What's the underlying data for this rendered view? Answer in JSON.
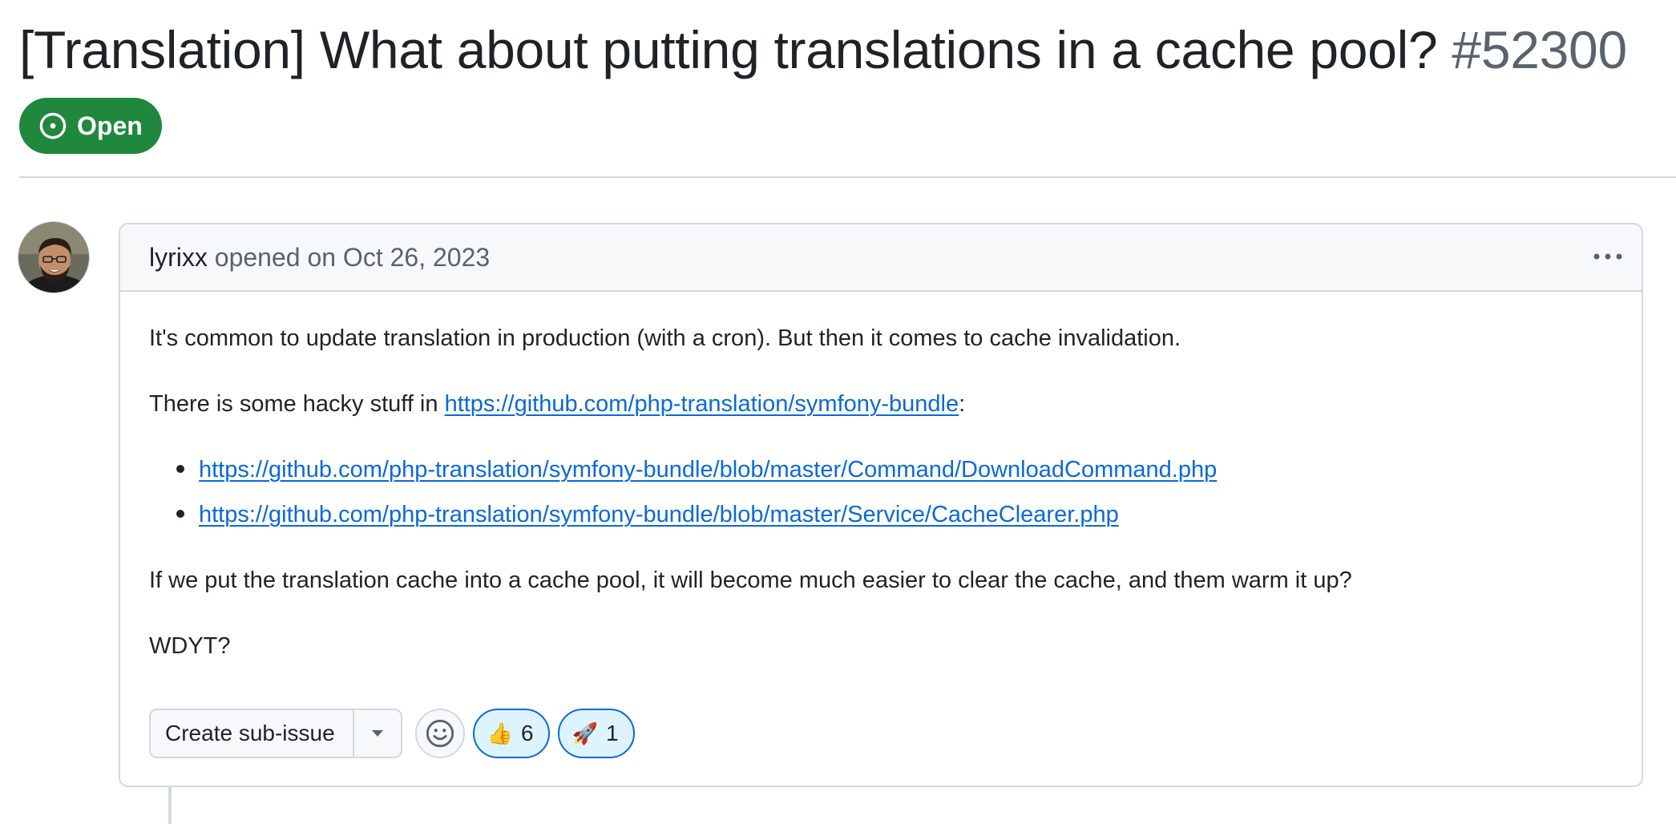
{
  "issue": {
    "title": "[Translation] What about putting translations in a cache pool?",
    "number": "#52300",
    "state": "Open",
    "state_color": "#1f883d"
  },
  "comment": {
    "author": "lyrixx",
    "opened_text": "opened on Oct 26, 2023",
    "body": {
      "p1": "It's common to update translation in production (with a cron). But then it comes to cache invalidation.",
      "p2_prefix": "There is some hacky stuff in ",
      "p2_link": "https://github.com/php-translation/symfony-bundle",
      "p2_suffix": ":",
      "bullets": [
        "https://github.com/php-translation/symfony-bundle/blob/master/Command/DownloadCommand.php",
        "https://github.com/php-translation/symfony-bundle/blob/master/Service/CacheClearer.php"
      ],
      "p3": "If we put the translation cache into a cache pool, it will become much easier to clear the cache, and them warm it up?",
      "p4": "WDYT?"
    }
  },
  "actions": {
    "create_sub_issue": "Create sub-issue",
    "emoji_picker_icon": "smiley-icon",
    "caret_icon": "triangle-down-icon"
  },
  "reactions": [
    {
      "emoji": "👍",
      "count": "6"
    },
    {
      "emoji": "🚀",
      "count": "1"
    }
  ],
  "colors": {
    "link": "#0969da",
    "reaction_bg": "#ddf4ff",
    "border": "#d1d9e0",
    "muted_text": "#59636e"
  }
}
